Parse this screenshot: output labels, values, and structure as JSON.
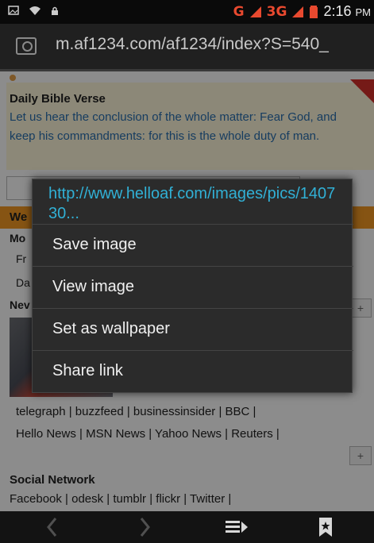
{
  "status_bar": {
    "network_g": "G",
    "network_3g": "3G",
    "time": "2:16",
    "time_suffix": "PM"
  },
  "url_bar": {
    "url": "m.af1234.com/af1234/index?S=540_"
  },
  "page": {
    "verse_title": "Daily Bible Verse",
    "verse_text": "Let us hear the conclusion of the whole matter: Fear God, and keep his commandments: for this is the whole duty of man.",
    "section_fragment": "We",
    "more_fragment": "Mo",
    "fr_fragment": "Fr",
    "da_fragment": "Da",
    "news_fragment": "Nev",
    "plus": "+",
    "news_line_1": "telegraph | buzzfeed | businessinsider | BBC |",
    "news_line_2": "Hello News | MSN News | Yahoo News | Reuters |",
    "social_title": "Social Network",
    "social_line": "Facebook | odesk | tumblr | flickr | Twitter |"
  },
  "context_menu": {
    "title": "http://www.helloaf.com/images/pics/140730...",
    "items": [
      {
        "label": "Save image"
      },
      {
        "label": "View image"
      },
      {
        "label": "Set as wallpaper"
      },
      {
        "label": "Share link"
      }
    ]
  },
  "bottom_bar": {
    "back_icon": "chevron-left-icon",
    "forward_icon": "chevron-right-icon",
    "tabs_icon": "tabs-icon",
    "bookmark_icon": "bookmark-icon"
  },
  "colors": {
    "accent": "#31b0d5",
    "orange_bar": "#f59a23",
    "verse_link": "#2a6fb0"
  }
}
